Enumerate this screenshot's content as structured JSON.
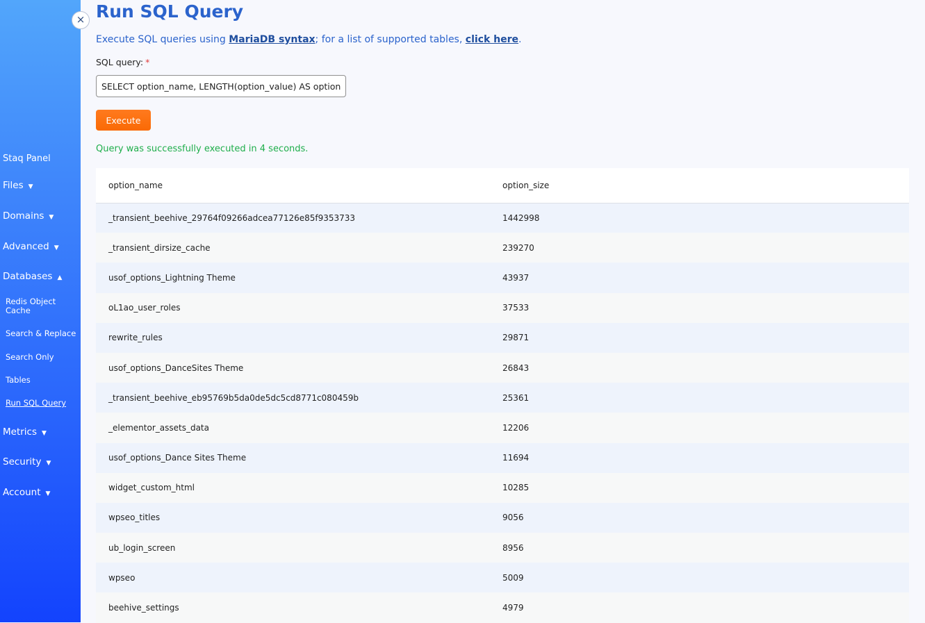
{
  "sidebar": {
    "panel_title": "Staq Panel",
    "close_icon": "×",
    "caret_down": "▼",
    "caret_up": "▲",
    "nav": {
      "files": "Files",
      "domains": "Domains",
      "advanced": "Advanced",
      "databases": "Databases",
      "metrics": "Metrics",
      "security": "Security",
      "account": "Account"
    },
    "databases_sub": {
      "redis": "Redis Object Cache",
      "search_replace": "Search & Replace",
      "search_only": "Search Only",
      "tables": "Tables",
      "run_sql": "Run SQL Query"
    }
  },
  "main": {
    "title": "Run SQL Query",
    "intro_prefix": "Execute SQL queries using ",
    "intro_link1": "MariaDB syntax",
    "intro_middle": "; for a list of supported tables, ",
    "intro_link2": "click here",
    "intro_suffix": ".",
    "query_label": "SQL query:",
    "required_mark": "*",
    "query_value": "SELECT option_name, LENGTH(option_value) AS option_size FROM wp_options ORDER BY option_size DESC",
    "execute_label": "Execute",
    "success_message": "Query was successfully executed in 4 seconds."
  },
  "table": {
    "columns": [
      "option_name",
      "option_size"
    ],
    "rows": [
      [
        "_transient_beehive_29764f09266adcea77126e85f9353733",
        "1442998"
      ],
      [
        "_transient_dirsize_cache",
        "239270"
      ],
      [
        "usof_options_Lightning Theme",
        "43937"
      ],
      [
        "oL1ao_user_roles",
        "37533"
      ],
      [
        "rewrite_rules",
        "29871"
      ],
      [
        "usof_options_DanceSites Theme",
        "26843"
      ],
      [
        "_transient_beehive_eb95769b5da0de5dc5cd8771c080459b",
        "25361"
      ],
      [
        "_elementor_assets_data",
        "12206"
      ],
      [
        "usof_options_Dance Sites Theme",
        "11694"
      ],
      [
        "widget_custom_html",
        "10285"
      ],
      [
        "wpseo_titles",
        "9056"
      ],
      [
        "ub_login_screen",
        "8956"
      ],
      [
        "wpseo",
        "5009"
      ],
      [
        "beehive_settings",
        "4979"
      ]
    ]
  },
  "colors": {
    "accent": "#2b63cc",
    "execute": "#fa6a05",
    "success": "#1fae4b",
    "sidebar_top": "#52a6fb",
    "sidebar_bottom": "#1343fd"
  }
}
